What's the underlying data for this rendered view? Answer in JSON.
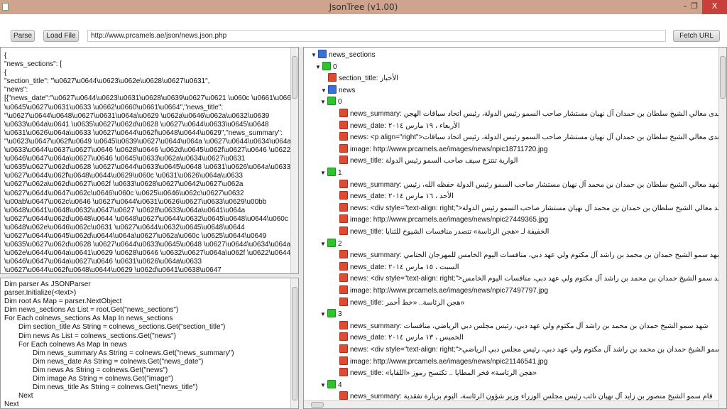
{
  "window": {
    "title": "JsonTree (v1.00)",
    "minimize": "–",
    "maximize": "❐",
    "close": "X"
  },
  "toolbar": {
    "parse": "Parse",
    "load_file": "Load File",
    "url": "http://www.prcamels.ae/json/news.json.php",
    "fetch_url": "Fetch URL"
  },
  "json_text": [
    "{",
    "\"news_sections\": [",
    "{",
    "\"section_title\": \"\\u0627\\u0644\\u0623\\u062e\\u0628\\u0627\\u0631\",",
    "\"news\":",
    "[{\"news_date\":\"\\u0627\\u0644\\u0623\\u0631\\u0628\\u0639\\u0627\\u0621 \\u060c \\u0661\\u0669",
    "\\u0645\\u0627\\u0631\\u0633  \\u0662\\u0660\\u0661\\u0664\",\"news_title\":",
    "\"\\u0627\\u0644\\u0648\\u0627\\u0631\\u064a\\u0629 \\u062a\\u0646\\u062a\\u0632\\u0639",
    "\\u0633\\u064a\\u0641 \\u0635\\u0627\\u062d\\u0628 \\u0627\\u0644\\u0633\\u0645\\u0648",
    "\\u0631\\u0626\\u064a\\u0633 \\u0627\\u0644\\u062f\\u0648\\u0644\\u0629\",\"news_summary\":",
    "\"\\u0623\\u0647\\u062f\\u0649 \\u0645\\u0639\\u0627\\u0644\\u064a \\u0627\\u0644\\u0634\\u064a\\u062e",
    "\\u0633\\u0644\\u0637\\u0627\\u0646 \\u0628\\u0646 \\u062d\\u0645\\u062f\\u0627\\u0646 \\u0622\\u0644",
    "\\u0646\\u0647\\u064a\\u0627\\u0646 \\u0645\\u0633\\u062a\\u0634\\u0627\\u0631",
    "\\u0635\\u0627\\u062d\\u0628 \\u0627\\u0644\\u0633\\u0645\\u0648 \\u0631\\u0626\\u064a\\u0633",
    "\\u0627\\u0644\\u062f\\u0648\\u0644\\u0629\\u060c \\u0631\\u0626\\u064a\\u0633",
    "\\u0627\\u062a\\u062d\\u0627\\u062f \\u0633\\u0628\\u0627\\u0642\\u0627\\u062a",
    "\\u0627\\u0644\\u0647\\u062c\\u0646\\u060c \\u0625\\u0646\\u062c\\u0627\\u0632",
    "\\u00ab\\u0647\\u062c\\u0646 \\u0627\\u0644\\u0631\\u0626\\u0627\\u0633\\u0629\\u00bb",
    "\\u0648\\u0641\\u0648\\u0632\\u0647\\u0627 \\u0628\\u0633\\u064a\\u0641\\u064a",
    "\\u0627\\u0644\\u062d\\u0648\\u0644 \\u0648\\u0627\\u0644\\u0632\\u0645\\u0648\\u0644\\u060c",
    "\\u0648\\u062e\\u0646\\u062c\\u0631 \\u0627\\u0644\\u0632\\u0645\\u0648\\u0644",
    "\\u0627\\u0644\\u0645\\u062d\\u0644\\u064a\\u0627\\u062a\\u060c \\u0625\\u0644\\u0649",
    "\\u0635\\u0627\\u062d\\u0628 \\u0627\\u0644\\u0633\\u0645\\u0648 \\u0627\\u0644\\u0634\\u064a\\u062e",
    "\\u062e\\u0644\\u064a\\u0641\\u0629 \\u0628\\u0646 \\u0632\\u0627\\u064a\\u062f \\u0622\\u0644",
    "\\u0646\\u0647\\u064a\\u0627\\u0646 \\u0631\\u0626\\u064a\\u0633",
    "\\u0627\\u0644\\u062f\\u0648\\u0644\\u0629 \\u062d\\u0641\\u0638\\u0647"
  ],
  "code_text": [
    {
      "indent": 0,
      "text": "Dim parser As JSONParser"
    },
    {
      "indent": 0,
      "text": "parser.Initialize(<text>)"
    },
    {
      "indent": 0,
      "text": "Dim root As Map = parser.NextObject"
    },
    {
      "indent": 0,
      "text": "Dim news_sections As List = root.Get(\"news_sections\")"
    },
    {
      "indent": 0,
      "text": "For Each colnews_sections As Map In news_sections"
    },
    {
      "indent": 1,
      "text": "Dim section_title As String = colnews_sections.Get(\"section_title\")"
    },
    {
      "indent": 1,
      "text": "Dim news As List = colnews_sections.Get(\"news\")"
    },
    {
      "indent": 1,
      "text": "For Each colnews As Map In news"
    },
    {
      "indent": 2,
      "text": "Dim news_summary As String = colnews.Get(\"news_summary\")"
    },
    {
      "indent": 2,
      "text": "Dim news_date As String = colnews.Get(\"news_date\")"
    },
    {
      "indent": 2,
      "text": "Dim news As String = colnews.Get(\"news\")"
    },
    {
      "indent": 2,
      "text": "Dim image As String = colnews.Get(\"image\")"
    },
    {
      "indent": 2,
      "text": "Dim news_title As String = colnews.Get(\"news_title\")"
    },
    {
      "indent": 1,
      "text": "Next"
    },
    {
      "indent": 0,
      "text": "Next"
    }
  ],
  "tree": [
    {
      "depth": 0,
      "type": "list",
      "expanded": true,
      "label": "news_sections"
    },
    {
      "depth": 1,
      "type": "map",
      "expanded": true,
      "label": "0"
    },
    {
      "depth": 2,
      "type": "value",
      "label": "section_title: الأخبار"
    },
    {
      "depth": 2,
      "type": "list",
      "expanded": true,
      "label": "news"
    },
    {
      "depth": 3,
      "type": "map",
      "expanded": true,
      "label": "0"
    },
    {
      "depth": 4,
      "type": "value",
      "label": "news_summary: أهدى معالي الشيخ سلطان بن حمدان آل نهيان مستشار صاحب السمو رئيس الدولة، رئيس اتحاد سباقات الهجن"
    },
    {
      "depth": 4,
      "type": "value",
      "label": "news_date: الأربعاء ، ١٩ مارس ٢٠١٤"
    },
    {
      "depth": 4,
      "type": "value",
      "label": "news: <p align=\"right\">أهدى معالي الشيخ سلطان بن حمدان آل نهيان مستشار صاحب السمو رئيس الدولة، رئيس اتحاد سباقات"
    },
    {
      "depth": 4,
      "type": "value",
      "label": "image: http://www.prcamels.ae/images/news/npic18711720.jpg"
    },
    {
      "depth": 4,
      "type": "value",
      "label": "news_title: الوارية تنتزع سيف صاحب السمو رئيس الدولة"
    },
    {
      "depth": 3,
      "type": "map",
      "expanded": true,
      "label": "1"
    },
    {
      "depth": 4,
      "type": "value",
      "label": "news_summary: شهد معالي الشيخ سلطان بن حمدان بن محمد آل نهيان مستشار صاحب السمو رئيس الدولة حفظه الله، رئيس"
    },
    {
      "depth": 4,
      "type": "value",
      "label": "news_date: الأحد ، ١٦ مارس ٢٠١٤"
    },
    {
      "depth": 4,
      "type": "value",
      "label": "news: <div style=\"text-align: right;\">شهد معالي الشيخ سلطان بن حمدان بن محمد آل نهيان مستشار صاحب السمو رئيس الدولة"
    },
    {
      "depth": 4,
      "type": "value",
      "label": "image: http://www.prcamels.ae/images/news/npic27449365.jpg"
    },
    {
      "depth": 4,
      "type": "value",
      "label": "news_title: الخفيفة لـ «هجن الرئاسة» تتصدر منافسات الشيوخ للثنايا"
    },
    {
      "depth": 3,
      "type": "map",
      "expanded": true,
      "label": "2"
    },
    {
      "depth": 4,
      "type": "value",
      "label": "news_summary: شهد سمو الشيخ حمدان بن محمد بن راشد آل مكتوم ولي عهد دبي، منافسات اليوم الخامس للمهرجان الختامي"
    },
    {
      "depth": 4,
      "type": "value",
      "label": "news_date: السبت ، ١٥ مارس ٢٠١٤"
    },
    {
      "depth": 4,
      "type": "value",
      "label": "news: <div style=\"text-align: right;\">شهد سمو الشيخ حمدان بن محمد بن راشد آل مكتوم ولي عهد دبي، منافسات اليوم الخامس"
    },
    {
      "depth": 4,
      "type": "value",
      "label": "image: http://www.prcamels.ae/images/news/npic77497797.jpg"
    },
    {
      "depth": 4,
      "type": "value",
      "label": "news_title: هجن الرئاسة.. «خط أحمر»"
    },
    {
      "depth": 3,
      "type": "map",
      "expanded": true,
      "label": "3"
    },
    {
      "depth": 4,
      "type": "value",
      "label": "news_summary: شهد سمو الشيخ حمدان بن محمد بن راشد آل مكتوم ولي عهد دبي، رئيس مجلس دبي الرياضي، منافسات"
    },
    {
      "depth": 4,
      "type": "value",
      "label": "news_date: الخميس ، ١٣ مارس ٢٠١٤"
    },
    {
      "depth": 4,
      "type": "value",
      "label": "news: <div style=\"text-align: right;\">شهد سمو الشيخ حمدان بن محمد بن راشد آل مكتوم ولي عهد دبي، رئيس مجلس دبي الرياضي"
    },
    {
      "depth": 4,
      "type": "value",
      "label": "image: http://www.prcamels.ae/images/news/npic21146541.jpg"
    },
    {
      "depth": 4,
      "type": "value",
      "label": "news_title: «هجن الرئاسة» فخر المطايا .. تكتسح رموز «اللقايا»"
    },
    {
      "depth": 3,
      "type": "map",
      "expanded": true,
      "label": "4"
    },
    {
      "depth": 4,
      "type": "value",
      "label": "news_summary: قام سمو الشيخ منصور بن زايد آل نهيان نائب رئيس مجلس الوزراء وزير شؤون الرئاسة، اليوم بزيارة تفقدية"
    },
    {
      "depth": 4,
      "type": "value",
      "label": ""
    }
  ],
  "colors": {
    "list": "#3a6fd8",
    "map": "#2ec42e",
    "value": "#e04a30",
    "titlebar": "#cfa48e"
  }
}
